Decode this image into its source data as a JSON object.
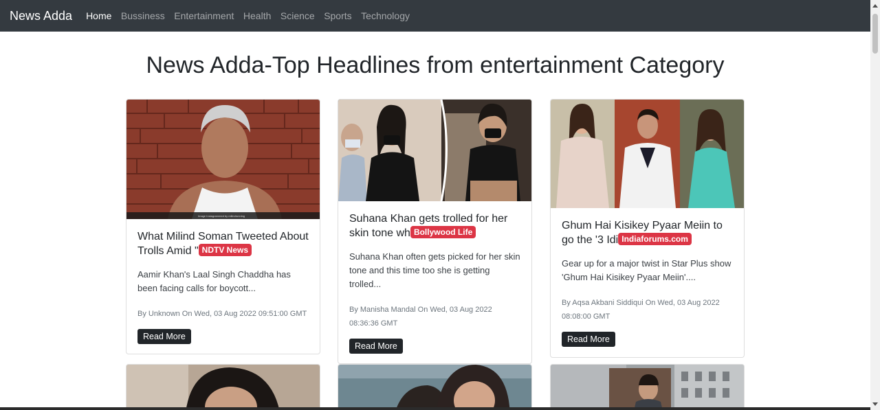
{
  "nav": {
    "brand": "News Adda",
    "links": [
      "Home",
      "Bussiness",
      "Entertainment",
      "Health",
      "Science",
      "Sports",
      "Technology"
    ]
  },
  "page": {
    "title": "News Adda-Top Headlines from entertainment Category"
  },
  "cards": [
    {
      "title": "What Milind Soman Tweeted About Trolls Amid \"",
      "source": "NDTV News",
      "text": "Aamir Khan's Laal Singh Chaddha has been facing calls for boycott...",
      "meta": "By Unknown On Wed, 03 Aug 2022 09:51:00 GMT",
      "button": "Read More",
      "image_caption": "Image Instagrammed by milindrunning"
    },
    {
      "title": "Suhana Khan gets trolled for her skin tone wh",
      "source": "Bollywood Life",
      "text": "Suhana Khan often gets picked for her skin tone and this time too she is getting trolled...",
      "meta": "By Manisha Mandal On Wed, 03 Aug 2022 08:36:36 GMT",
      "button": "Read More"
    },
    {
      "title": "Ghum Hai Kisikey Pyaar Meiin to go the '3 Idi",
      "source": "Indiaforums.com",
      "text": "Gear up for a major twist in Star Plus show 'Ghum Hai Kisikey Pyaar Meiin'....",
      "meta": "By Aqsa Akbani Siddiqui On Wed, 03 Aug 2022 08:08:00 GMT",
      "button": "Read More"
    }
  ],
  "colors": {
    "navbar": "#343a40",
    "badge": "#dc3545",
    "button": "#212529"
  }
}
